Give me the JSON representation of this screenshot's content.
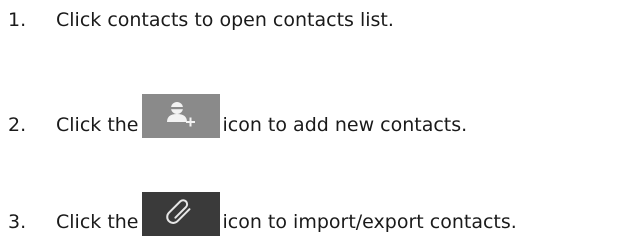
{
  "steps": [
    {
      "number": "1.",
      "text": "Click contacts to open contacts list."
    },
    {
      "number": "2.",
      "before": "Click the",
      "icon": "add-contact-icon",
      "after": "icon to add new contacts."
    },
    {
      "number": "3.",
      "before": "Click the",
      "icon": "paperclip-icon",
      "after": "icon to import/export contacts."
    }
  ],
  "colors": {
    "text": "#1a1a1a",
    "add_icon_bg": "#8a8a8a",
    "clip_icon_bg": "#3a3a3a"
  }
}
